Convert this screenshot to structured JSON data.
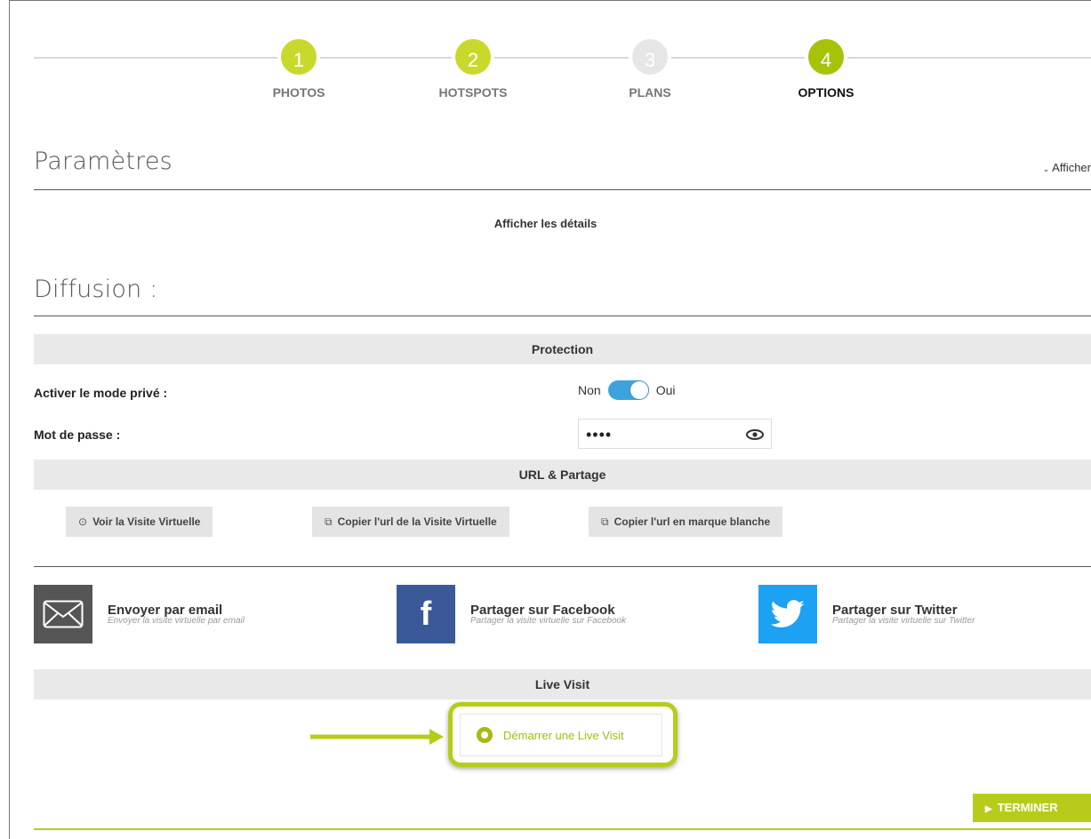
{
  "stepper": {
    "steps": [
      {
        "num": "1",
        "label": "PHOTOS",
        "state": "done"
      },
      {
        "num": "2",
        "label": "HOTSPOTS",
        "state": "done"
      },
      {
        "num": "3",
        "label": "PLANS",
        "state": "todo"
      },
      {
        "num": "4",
        "label": "OPTIONS",
        "state": "active"
      }
    ]
  },
  "parametres": {
    "title": "Paramètres",
    "toggle_label": "Afficher",
    "details_label": "Afficher les détails"
  },
  "diffusion": {
    "title": "Diffusion :",
    "protection": {
      "header": "Protection",
      "private_label": "Activer le mode privé :",
      "switch_off": "Non",
      "switch_on": "Oui",
      "password_label": "Mot de passe :",
      "password_value": "••••"
    },
    "url": {
      "header": "URL & Partage",
      "buttons": [
        "Voir la Visite Virtuelle",
        "Copier l'url de la Visite Virtuelle",
        "Copier l'url en marque blanche"
      ]
    },
    "share": [
      {
        "title": "Envoyer par email",
        "subtitle": "Envoyer la visite virtuelle par email"
      },
      {
        "title": "Partager sur Facebook",
        "subtitle": "Partager la visite virtuelle sur Facebook"
      },
      {
        "title": "Partager sur Twitter",
        "subtitle": "Partager la visite virtuelle sur Twitter"
      }
    ],
    "live": {
      "header": "Live Visit",
      "button": "Démarrer une Live Visit"
    }
  },
  "footer": {
    "finish_label": "TERMINER"
  },
  "colors": {
    "accent": "#b7cc1a",
    "switch": "#3ea3dc",
    "facebook": "#3b5998",
    "twitter": "#1da1f2",
    "email": "#555555"
  }
}
